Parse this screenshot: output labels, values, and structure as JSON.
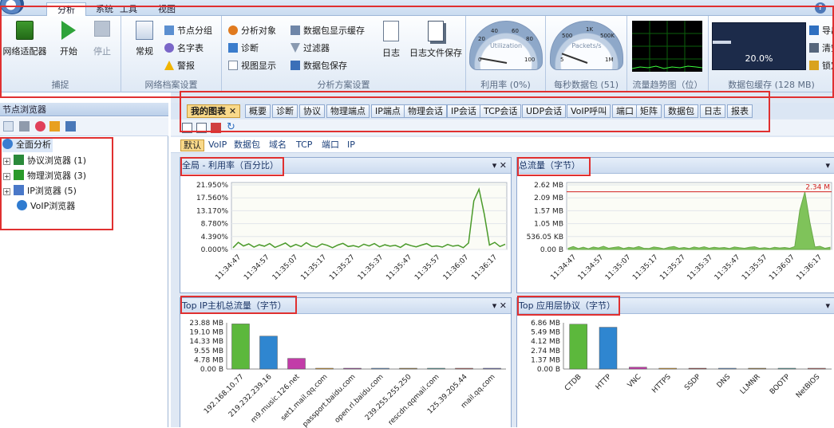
{
  "ribbon_tabs": [
    "分析",
    "系统",
    "工具",
    "视图"
  ],
  "ribbon": {
    "capture": {
      "label": "捕捉",
      "buttons": [
        "网络适配器",
        "开始",
        "停止"
      ]
    },
    "profile": {
      "label": "网络档案设置",
      "big": "常规",
      "small": [
        "节点分组",
        "名字表",
        "警报"
      ]
    },
    "scheme": {
      "label": "分析方案设置",
      "small_col1": [
        "分析对象",
        "诊断",
        "视图显示"
      ],
      "small_col2": [
        "数据包显示缓存",
        "过滤器",
        "数据包保存"
      ],
      "big": [
        "日志",
        "日志文件保存"
      ]
    },
    "utilization": {
      "label": "利用率 (0%)",
      "gauge_text": "Utilization",
      "ticks": [
        "20",
        "40",
        "60",
        "80",
        "0",
        "100"
      ]
    },
    "packets": {
      "label": "每秒数据包 (51)",
      "gauge_text": "Packets/s",
      "ticks": [
        "500",
        "1K",
        "500K",
        "5",
        "1M"
      ]
    },
    "trend": {
      "label": "流量趋势图（位）"
    },
    "buffer": {
      "label": "数据包缓存 (128 MB)",
      "percent_text": "20.0%",
      "percent": 20.0
    },
    "right_buttons": [
      "导出",
      "清空",
      "锁定"
    ]
  },
  "sidebar": {
    "title": "节点浏览器",
    "root": "全面分析",
    "items": [
      "协议浏览器 (1)",
      "物理浏览器 (3)",
      "IP浏览器 (5)",
      "VoIP浏览器"
    ]
  },
  "doc_tabs": [
    "我的图表",
    "概要",
    "诊断",
    "协议",
    "物理端点",
    "IP端点",
    "物理会话",
    "IP会话",
    "TCP会话",
    "UDP会话",
    "VoIP呼叫",
    "端口",
    "矩阵",
    "数据包",
    "日志",
    "报表"
  ],
  "filters": [
    "默认",
    "VoIP",
    "数据包",
    "域名",
    "TCP",
    "端口",
    "IP"
  ],
  "colors": {
    "line_green": "#4a9a2a",
    "area_green": "#7fc35a",
    "bar_green": "#5cb83c",
    "bar_blue": "#2f86d0",
    "bar_magenta": "#c23ca8",
    "peak_red": "#d02020"
  },
  "chart_data": [
    {
      "type": "line",
      "title": "全局 - 利用率（百分比）",
      "x": [
        "11:34:47",
        "11:34:57",
        "11:35:07",
        "11:35:17",
        "11:35:27",
        "11:35:37",
        "11:35:47",
        "11:35:57",
        "11:36:07",
        "11:36:17"
      ],
      "yticks": [
        "21.950%",
        "17.560%",
        "13.170%",
        "8.780%",
        "4.390%",
        "0.000%"
      ],
      "ylim": [
        0,
        21.95
      ],
      "series": [
        {
          "values": [
            0.6,
            2.4,
            1.2,
            1.9,
            0.8,
            1.6,
            1.1,
            2.0,
            0.7,
            1.4,
            2.2,
            0.9,
            1.7,
            1.0,
            2.3,
            1.2,
            0.8,
            1.9,
            1.4,
            0.6,
            1.5,
            2.1,
            1.0,
            1.3,
            0.8,
            1.8,
            1.2,
            2.0,
            0.9,
            1.6,
            1.1,
            1.4,
            0.7,
            1.9,
            1.3,
            0.9,
            1.5,
            2.0,
            1.0,
            1.2,
            0.8,
            1.7,
            1.1,
            1.4,
            0.6,
            2.2,
            16.5,
            20.5,
            12.0,
            1.5,
            2.4,
            1.0,
            1.8
          ]
        }
      ]
    },
    {
      "type": "area",
      "title": "总流量（字节）",
      "x": [
        "11:34:47",
        "11:34:57",
        "11:35:07",
        "11:35:17",
        "11:35:27",
        "11:35:37",
        "11:35:47",
        "11:35:57",
        "11:36:07",
        "11:36:17"
      ],
      "yticks": [
        "2.62 MB",
        "2.09 MB",
        "1.57 MB",
        "1.05 MB",
        "536.05 KB",
        "0.00 B"
      ],
      "ylim": [
        0,
        2.62
      ],
      "peak_label": "2.34 M",
      "peak_value": 2.34,
      "series": [
        {
          "values": [
            0.05,
            0.12,
            0.04,
            0.09,
            0.03,
            0.1,
            0.06,
            0.13,
            0.05,
            0.08,
            0.11,
            0.04,
            0.09,
            0.06,
            0.12,
            0.05,
            0.04,
            0.1,
            0.07,
            0.03,
            0.09,
            0.12,
            0.05,
            0.08,
            0.04,
            0.1,
            0.06,
            0.11,
            0.05,
            0.09,
            0.06,
            0.08,
            0.04,
            0.1,
            0.07,
            0.05,
            0.09,
            0.11,
            0.05,
            0.07,
            0.04,
            0.09,
            0.06,
            0.08,
            0.05,
            0.12,
            1.6,
            2.34,
            1.1,
            0.1,
            0.13,
            0.05,
            0.09
          ]
        }
      ]
    },
    {
      "type": "bar",
      "title": "Top IP主机总流量（字节）",
      "categories": [
        "192.168.10.77",
        "219.232.239.16",
        "m9.music.126.net",
        "set1.mail.qq.com",
        "passport.baidu.com",
        "open.rl.baidu.com",
        "239.255.255.250",
        "rescdn.qqmail.com",
        "125.39.205.44",
        "mail.qq.com"
      ],
      "values": [
        23.3,
        17.0,
        5.5,
        0.12,
        0.1,
        0.08,
        0.07,
        0.05,
        0.04,
        0.03
      ],
      "yticks": [
        "23.88 MB",
        "19.10 MB",
        "14.33 MB",
        "9.55 MB",
        "4.78 MB",
        "0.00 B"
      ],
      "ylim": [
        0,
        23.88
      ]
    },
    {
      "type": "bar",
      "title": "Top 应用层协议（字节）",
      "categories": [
        "CTDB",
        "HTTP",
        "VNC",
        "HTTPS",
        "SSDP",
        "DNS",
        "LLMNR",
        "BOOTP",
        "NetBIOS"
      ],
      "values": [
        6.65,
        6.2,
        0.28,
        0.1,
        0.08,
        0.05,
        0.04,
        0.03,
        0.02
      ],
      "yticks": [
        "6.86 MB",
        "5.49 MB",
        "4.12 MB",
        "2.74 MB",
        "1.37 MB",
        "0.00 B"
      ],
      "ylim": [
        0,
        6.86
      ]
    }
  ]
}
